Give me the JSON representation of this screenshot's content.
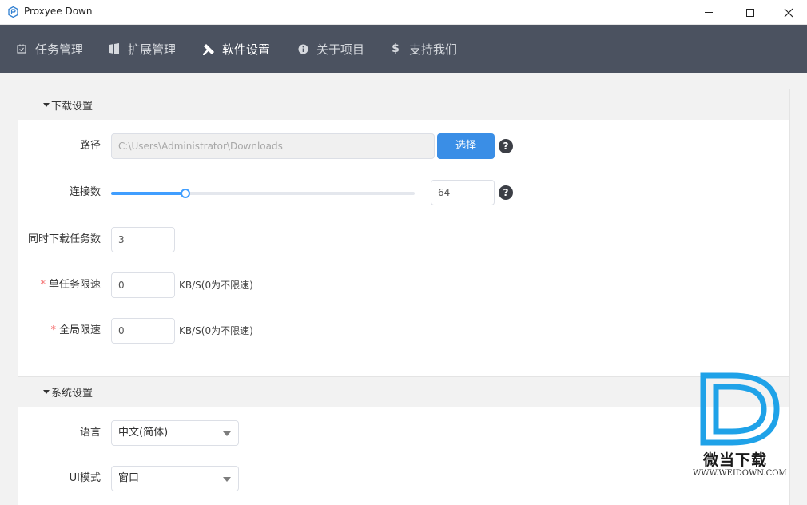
{
  "window": {
    "title": "Proxyee Down"
  },
  "nav": {
    "items": [
      {
        "label": "任务管理",
        "icon": "task-icon"
      },
      {
        "label": "扩展管理",
        "icon": "extension-icon"
      },
      {
        "label": "软件设置",
        "icon": "tools-icon",
        "active": true
      },
      {
        "label": "关于项目",
        "icon": "info-icon"
      },
      {
        "label": "支持我们",
        "icon": "dollar-icon"
      }
    ]
  },
  "download_settings": {
    "section_title": "下载设置",
    "path": {
      "label": "路径",
      "value": "C:\\Users\\Administrator\\Downloads",
      "button": "选择",
      "help": "?"
    },
    "connections": {
      "label": "连接数",
      "value": "64",
      "slider_fraction": 0.245,
      "help": "?"
    },
    "concurrent": {
      "label": "同时下载任务数",
      "value": "3"
    },
    "task_limit": {
      "label": "单任务限速",
      "required": "*",
      "value": "0",
      "unit": "KB/S(0为不限速)"
    },
    "global_limit": {
      "label": "全局限速",
      "required": "*",
      "value": "0",
      "unit": "KB/S(0为不限速)"
    }
  },
  "system_settings": {
    "section_title": "系统设置",
    "language": {
      "label": "语言",
      "value": "中文(简体)"
    },
    "ui_mode": {
      "label": "UI模式",
      "value": "窗口"
    }
  },
  "watermark": {
    "text": "微当下载",
    "url": "WWW.WEIDOWN.COM"
  },
  "colors": {
    "nav_bg": "#4b5260",
    "primary": "#3a8ee6",
    "logo_blue": "#1fa2e8"
  }
}
